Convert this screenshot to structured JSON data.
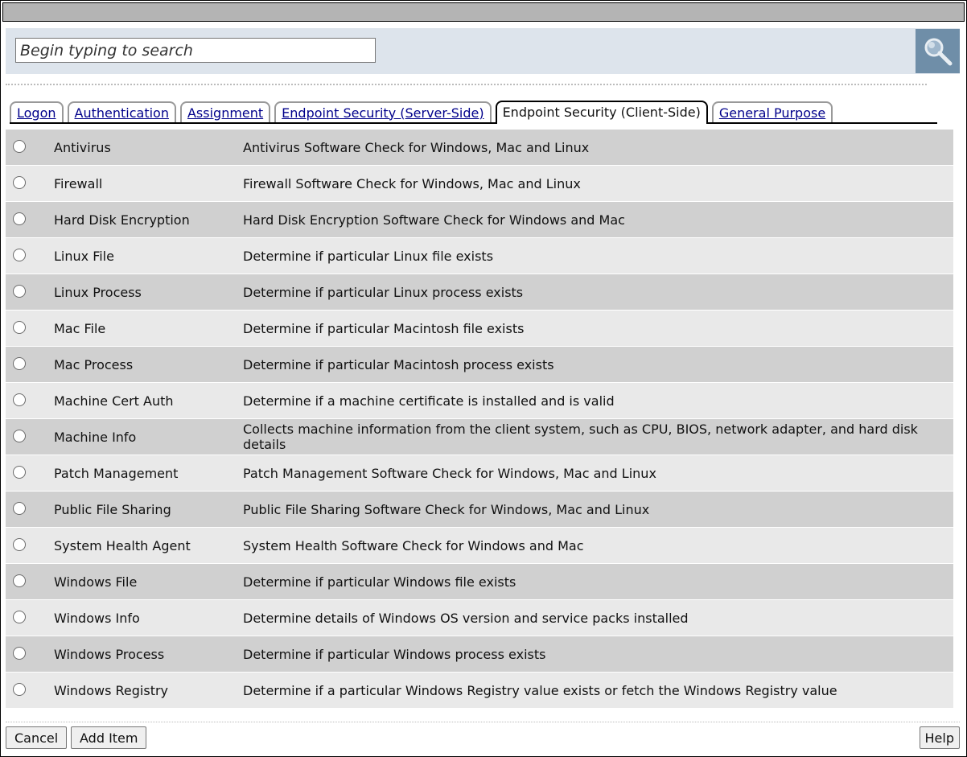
{
  "search": {
    "placeholder": "Begin typing to search",
    "button_icon": "search-icon"
  },
  "tabs": [
    {
      "label": "Logon",
      "active": false
    },
    {
      "label": "Authentication",
      "active": false
    },
    {
      "label": "Assignment",
      "active": false
    },
    {
      "label": "Endpoint Security (Server-Side)",
      "active": false
    },
    {
      "label": "Endpoint Security (Client-Side)",
      "active": true
    },
    {
      "label": "General Purpose",
      "active": false
    }
  ],
  "items": [
    {
      "name": "Antivirus",
      "description": "Antivirus Software Check for Windows, Mac and Linux"
    },
    {
      "name": "Firewall",
      "description": "Firewall Software Check for Windows, Mac and Linux"
    },
    {
      "name": "Hard Disk Encryption",
      "description": "Hard Disk Encryption Software Check for Windows and Mac"
    },
    {
      "name": "Linux File",
      "description": "Determine if particular Linux file exists"
    },
    {
      "name": "Linux Process",
      "description": "Determine if particular Linux process exists"
    },
    {
      "name": "Mac File",
      "description": "Determine if particular Macintosh file exists"
    },
    {
      "name": "Mac Process",
      "description": "Determine if particular Macintosh process exists"
    },
    {
      "name": "Machine Cert Auth",
      "description": "Determine if a machine certificate is installed and is valid"
    },
    {
      "name": "Machine Info",
      "description": "Collects machine information from the client system, such as CPU, BIOS, network adapter, and hard disk details"
    },
    {
      "name": "Patch Management",
      "description": "Patch Management Software Check for Windows, Mac and Linux"
    },
    {
      "name": "Public File Sharing",
      "description": "Public File Sharing Software Check for Windows, Mac and Linux"
    },
    {
      "name": "System Health Agent",
      "description": "System Health Software Check for Windows and Mac"
    },
    {
      "name": "Windows File",
      "description": "Determine if particular Windows file exists"
    },
    {
      "name": "Windows Info",
      "description": "Determine details of Windows OS version and service packs installed"
    },
    {
      "name": "Windows Process",
      "description": "Determine if particular Windows process exists"
    },
    {
      "name": "Windows Registry",
      "description": "Determine if a particular Windows Registry value exists or fetch the Windows Registry value"
    }
  ],
  "buttons": {
    "cancel": "Cancel",
    "add_item": "Add Item",
    "help": "Help"
  },
  "colors": {
    "search_bar_bg": "#dde4ec",
    "search_button_bg": "#6f8ea8",
    "row_odd": "#d0d0d0",
    "row_even": "#e9e9e9",
    "link": "#00008b"
  }
}
